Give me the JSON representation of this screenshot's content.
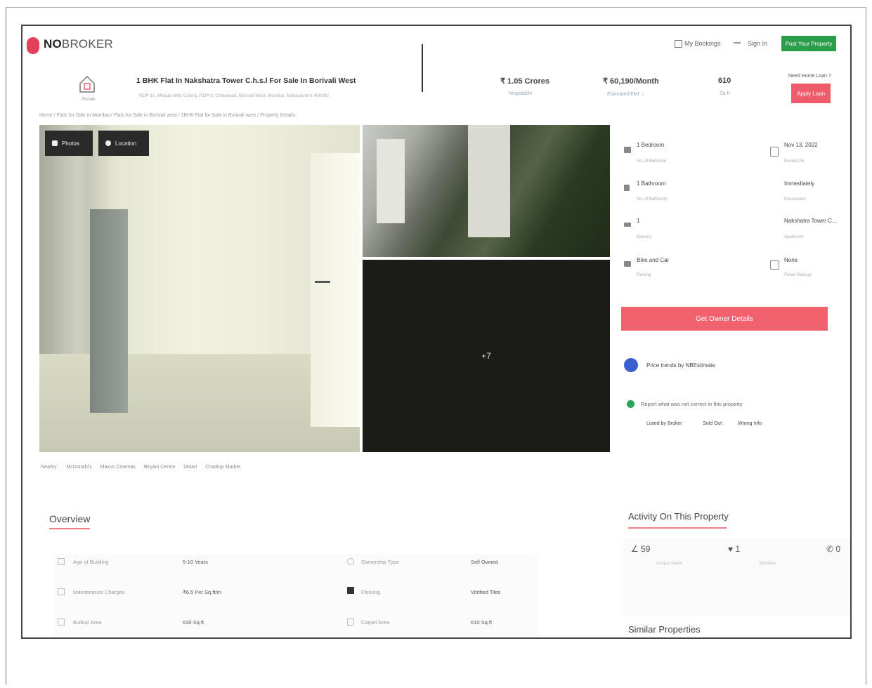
{
  "header": {
    "logo_no": "NO",
    "logo_broker": "BROKER",
    "my_bookings": "My Bookings",
    "sign_in": "Sign In",
    "post_property": "Post Your Property"
  },
  "listing": {
    "home_label": "Resale",
    "title": "1 BHK Flat In Nakshatra Tower C.h.s.l For Sale In Borivali West",
    "address": "RDP 10, Mhada Mhb Colony, RDP 8, Chikuwadi, Borivali West, Mumbai, Maharashtra 400092",
    "price": "₹ 1.05 Crores",
    "price_sub": "Negotiable",
    "emi": "₹ 60,190/Month",
    "emi_sub": "Estimated EMI ⌄",
    "area": "610",
    "area_sub": "Sq.ft",
    "loan_question": "Need Home Loan ?",
    "apply_loan": "Apply Loan"
  },
  "breadcrumb": "Home / Flats for Sale in Mumbai / Flats for Sale in Borivali west / 1BHK Flat for Sale in Borivali west / Property Details",
  "gallery": {
    "photos_label": "Photos",
    "location_label": "Location",
    "more_count": "+7"
  },
  "details": [
    {
      "value": "1 Bedroom",
      "sub": "No. of Bedroom"
    },
    {
      "value": "Nov 13, 2022",
      "sub": "Posted On"
    },
    {
      "value": "1 Bathroom",
      "sub": "No. of Bathroom"
    },
    {
      "value": "Immediately",
      "sub": "Possession"
    },
    {
      "value": "1",
      "sub": "Balcony"
    },
    {
      "value": "Nakshatra Tower C...",
      "sub": "Apartment"
    },
    {
      "value": "Bike and Car",
      "sub": "Parking"
    },
    {
      "value": "None",
      "sub": "Power Backup"
    }
  ],
  "actions": {
    "get_owner": "Get Owner Details",
    "price_trends": "Price trends by NBEstimate",
    "report_prompt": "Report what was not correct in this property",
    "report_options": [
      "Listed by Broker",
      "Sold Out",
      "Wrong Info"
    ]
  },
  "nearby": {
    "label": "Nearby:",
    "places": [
      "McDonald's",
      "Maxus Cinemas",
      "Biryani Centre",
      "DMart",
      "Charkop Market"
    ]
  },
  "overview": {
    "title": "Overview",
    "rows": [
      {
        "label": "Age of Building",
        "value": "5-10 Years",
        "label2": "Ownership Type",
        "value2": "Self Owned"
      },
      {
        "label": "Maintenance Charges",
        "value": "₹6.5 Per Sq.ft/m",
        "label2": "Flooring",
        "value2": "Vitrified Tiles"
      },
      {
        "label": "Builtup Area",
        "value": "630 Sq.ft",
        "label2": "Carpet Area",
        "value2": "610 Sq.ft"
      }
    ]
  },
  "activity": {
    "title": "Activity On This Property",
    "views": "59",
    "views_sub": "Unique Views",
    "shortlists": "1",
    "shortlists_sub": "Shortlists",
    "contacts": "0",
    "similar_title": "Similar Properties"
  }
}
